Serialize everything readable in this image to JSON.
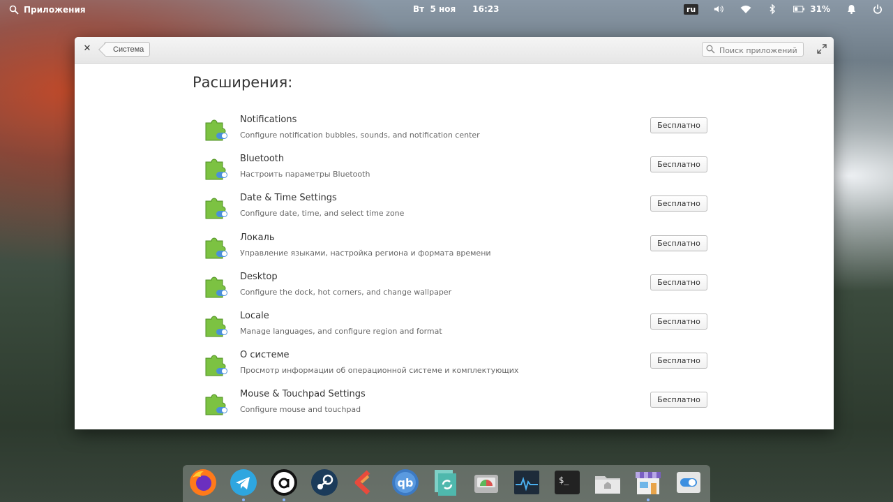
{
  "panel": {
    "apps_label": "Приложения",
    "day": "Вт",
    "date": "5 ноя",
    "time": "16:23",
    "keyboard_layout": "ru",
    "battery": "31%"
  },
  "window": {
    "back_label": "Система",
    "search_placeholder": "Поиск приложений",
    "section_title": "Расширения:",
    "items": [
      {
        "name": "Notifications",
        "desc": "Configure notification bubbles, sounds, and notification center",
        "price": "Бесплатно"
      },
      {
        "name": "Bluetooth",
        "desc": "Настроить параметры Bluetooth",
        "price": "Бесплатно"
      },
      {
        "name": "Date & Time Settings",
        "desc": "Configure date, time, and select time zone",
        "price": "Бесплатно"
      },
      {
        "name": "Локаль",
        "desc": "Управление языками, настройка региона и формата времени",
        "price": "Бесплатно"
      },
      {
        "name": "Desktop",
        "desc": "Configure the dock, hot corners, and change wallpaper",
        "price": "Бесплатно"
      },
      {
        "name": "Locale",
        "desc": "Manage languages, and configure region and format",
        "price": "Бесплатно"
      },
      {
        "name": "О системе",
        "desc": "Просмотр информации об операционной системе и комплектующих",
        "price": "Бесплатно"
      },
      {
        "name": "Mouse & Touchpad Settings",
        "desc": "Configure mouse and touchpad",
        "price": "Бесплатно"
      }
    ]
  },
  "dock": {
    "apps": [
      "firefox-icon",
      "telegram-icon",
      "anydesk-icon",
      "steam-icon",
      "kodi-icon",
      "qbittorrent-icon",
      "sync-icon",
      "disk-usage-icon",
      "system-monitor-icon",
      "terminal-icon",
      "files-icon",
      "appcenter-icon",
      "settings-icon"
    ],
    "accent": "#8ab4ff"
  }
}
